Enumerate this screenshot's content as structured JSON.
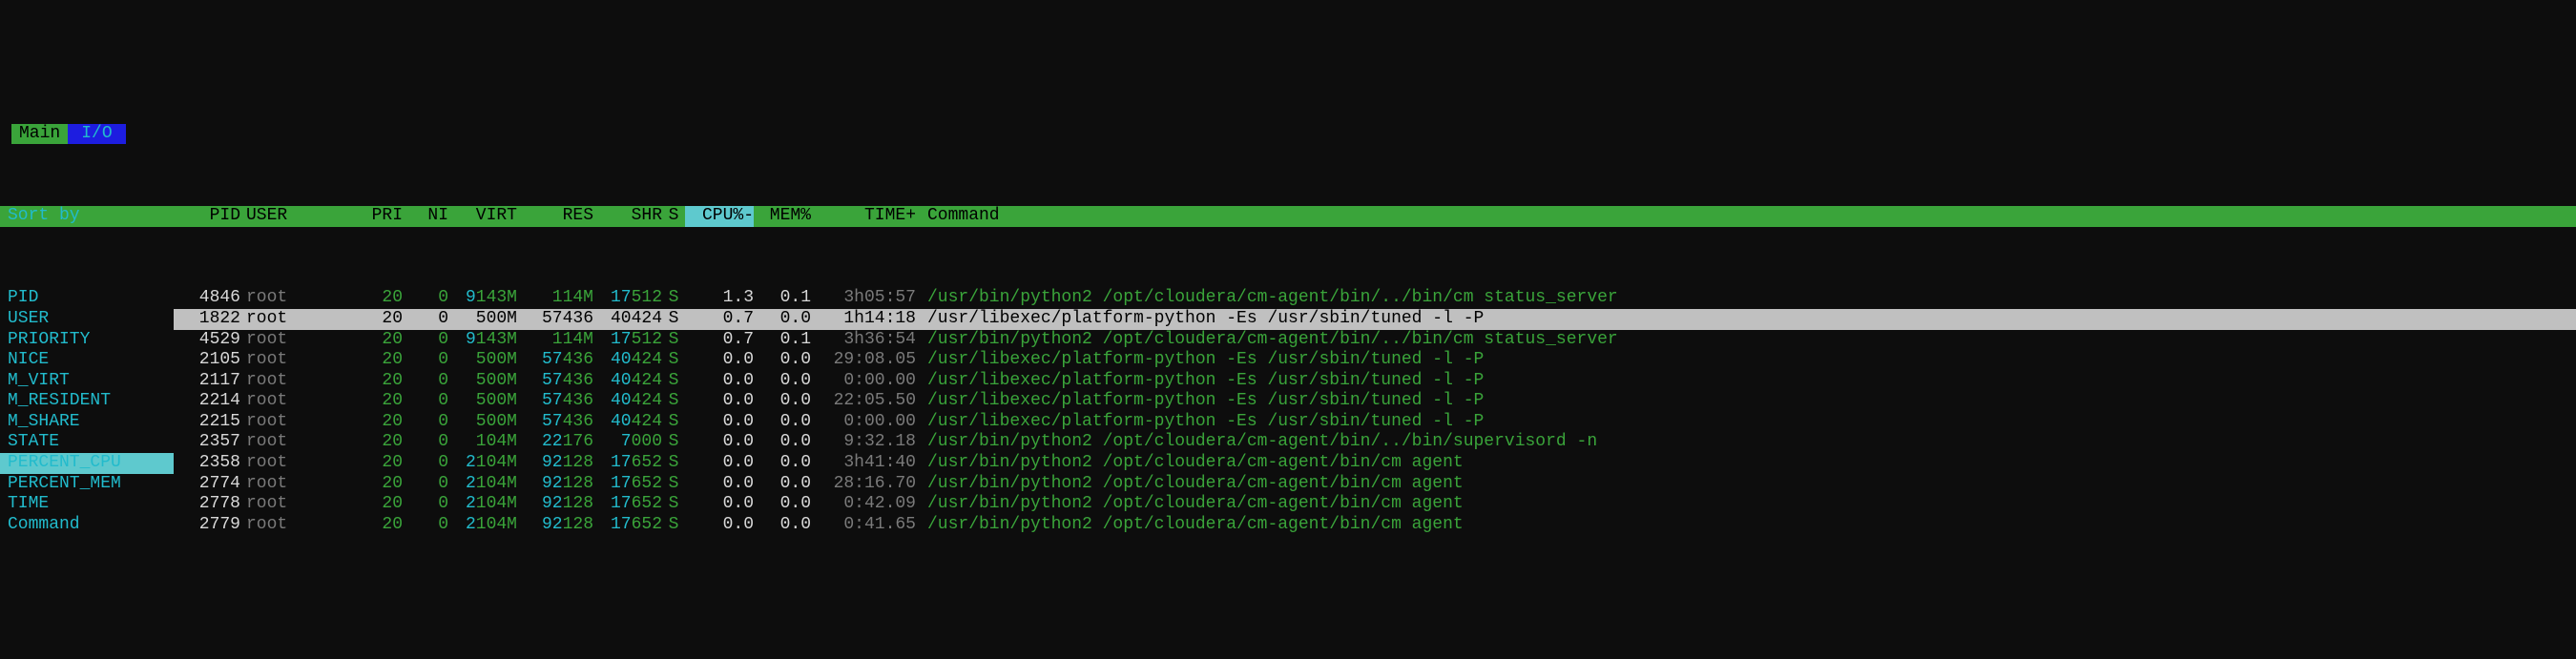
{
  "tabs": {
    "main": "Main",
    "io": "I/O"
  },
  "sort": {
    "title": "Sort by",
    "items": [
      "PID",
      "USER",
      "PRIORITY",
      "NICE",
      "M_VIRT",
      "M_RESIDENT",
      "M_SHARE",
      "STATE",
      "PERCENT_CPU",
      "PERCENT_MEM",
      "TIME",
      "Command"
    ],
    "selected_index": 8
  },
  "headers": {
    "pid": "PID",
    "user": "USER",
    "pri": "PRI",
    "ni": "NI",
    "virt": "VIRT",
    "res": "RES",
    "shr": "SHR",
    "s": "S",
    "cpu": "CPU%",
    "mem": "MEM%",
    "time": "TIME+",
    "cmd": "Command"
  },
  "selected_row_index": 1,
  "rows": [
    {
      "pid": "4846",
      "user": "root",
      "pri": "20",
      "ni": "0",
      "virt_lead": "9",
      "virt_tail": "143M",
      "res_lead": "",
      "res_tail": "114M",
      "shr_lead": "17",
      "shr_tail": "512",
      "s": "S",
      "cpu": "1.3",
      "mem": "0.1",
      "time": "3h05:57",
      "cmd": "/usr/bin/python2 /opt/cloudera/cm-agent/bin/../bin/cm status_server"
    },
    {
      "pid": "1822",
      "user": "root",
      "pri": "20",
      "ni": "0",
      "virt_lead": "",
      "virt_tail": "500M",
      "res_lead": "57",
      "res_tail": "436",
      "shr_lead": "40",
      "shr_tail": "424",
      "s": "S",
      "cpu": "0.7",
      "mem": "0.0",
      "time": "1h14:18",
      "cmd": "/usr/libexec/platform-python -Es /usr/sbin/tuned -l -P"
    },
    {
      "pid": "4529",
      "user": "root",
      "pri": "20",
      "ni": "0",
      "virt_lead": "9",
      "virt_tail": "143M",
      "res_lead": "",
      "res_tail": "114M",
      "shr_lead": "17",
      "shr_tail": "512",
      "s": "S",
      "cpu": "0.7",
      "mem": "0.1",
      "time": "3h36:54",
      "cmd": "/usr/bin/python2 /opt/cloudera/cm-agent/bin/../bin/cm status_server"
    },
    {
      "pid": "2105",
      "user": "root",
      "pri": "20",
      "ni": "0",
      "virt_lead": "",
      "virt_tail": "500M",
      "res_lead": "57",
      "res_tail": "436",
      "shr_lead": "40",
      "shr_tail": "424",
      "s": "S",
      "cpu": "0.0",
      "mem": "0.0",
      "time": "29:08.05",
      "cmd": "/usr/libexec/platform-python -Es /usr/sbin/tuned -l -P"
    },
    {
      "pid": "2117",
      "user": "root",
      "pri": "20",
      "ni": "0",
      "virt_lead": "",
      "virt_tail": "500M",
      "res_lead": "57",
      "res_tail": "436",
      "shr_lead": "40",
      "shr_tail": "424",
      "s": "S",
      "cpu": "0.0",
      "mem": "0.0",
      "time": "0:00.00",
      "cmd": "/usr/libexec/platform-python -Es /usr/sbin/tuned -l -P"
    },
    {
      "pid": "2214",
      "user": "root",
      "pri": "20",
      "ni": "0",
      "virt_lead": "",
      "virt_tail": "500M",
      "res_lead": "57",
      "res_tail": "436",
      "shr_lead": "40",
      "shr_tail": "424",
      "s": "S",
      "cpu": "0.0",
      "mem": "0.0",
      "time": "22:05.50",
      "cmd": "/usr/libexec/platform-python -Es /usr/sbin/tuned -l -P"
    },
    {
      "pid": "2215",
      "user": "root",
      "pri": "20",
      "ni": "0",
      "virt_lead": "",
      "virt_tail": "500M",
      "res_lead": "57",
      "res_tail": "436",
      "shr_lead": "40",
      "shr_tail": "424",
      "s": "S",
      "cpu": "0.0",
      "mem": "0.0",
      "time": "0:00.00",
      "cmd": "/usr/libexec/platform-python -Es /usr/sbin/tuned -l -P"
    },
    {
      "pid": "2357",
      "user": "root",
      "pri": "20",
      "ni": "0",
      "virt_lead": "",
      "virt_tail": "104M",
      "res_lead": "22",
      "res_tail": "176",
      "shr_lead": "7",
      "shr_tail": "000",
      "s": "S",
      "cpu": "0.0",
      "mem": "0.0",
      "time": "9:32.18",
      "cmd": "/usr/bin/python2 /opt/cloudera/cm-agent/bin/../bin/supervisord -n"
    },
    {
      "pid": "2358",
      "user": "root",
      "pri": "20",
      "ni": "0",
      "virt_lead": "2",
      "virt_tail": "104M",
      "res_lead": "92",
      "res_tail": "128",
      "shr_lead": "17",
      "shr_tail": "652",
      "s": "S",
      "cpu": "0.0",
      "mem": "0.0",
      "time": "3h41:40",
      "cmd": "/usr/bin/python2 /opt/cloudera/cm-agent/bin/cm agent"
    },
    {
      "pid": "2774",
      "user": "root",
      "pri": "20",
      "ni": "0",
      "virt_lead": "2",
      "virt_tail": "104M",
      "res_lead": "92",
      "res_tail": "128",
      "shr_lead": "17",
      "shr_tail": "652",
      "s": "S",
      "cpu": "0.0",
      "mem": "0.0",
      "time": "28:16.70",
      "cmd": "/usr/bin/python2 /opt/cloudera/cm-agent/bin/cm agent"
    },
    {
      "pid": "2778",
      "user": "root",
      "pri": "20",
      "ni": "0",
      "virt_lead": "2",
      "virt_tail": "104M",
      "res_lead": "92",
      "res_tail": "128",
      "shr_lead": "17",
      "shr_tail": "652",
      "s": "S",
      "cpu": "0.0",
      "mem": "0.0",
      "time": "0:42.09",
      "cmd": "/usr/bin/python2 /opt/cloudera/cm-agent/bin/cm agent"
    },
    {
      "pid": "2779",
      "user": "root",
      "pri": "20",
      "ni": "0",
      "virt_lead": "2",
      "virt_tail": "104M",
      "res_lead": "92",
      "res_tail": "128",
      "shr_lead": "17",
      "shr_tail": "652",
      "s": "S",
      "cpu": "0.0",
      "mem": "0.0",
      "time": "0:41.65",
      "cmd": "/usr/bin/python2 /opt/cloudera/cm-agent/bin/cm agent"
    }
  ]
}
